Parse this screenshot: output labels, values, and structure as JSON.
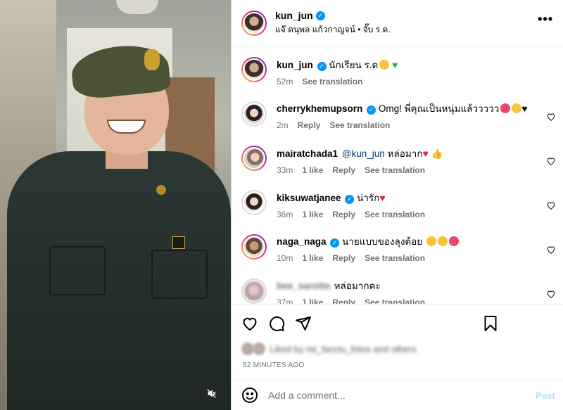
{
  "post": {
    "author": "kun_jun",
    "subtitle": "แจ๊ ดนุพล แก้วกาญจน์ • จั๊บ ร.ด."
  },
  "caption": {
    "user": "kun_jun",
    "text": "นักเรียน ร.ด",
    "time": "52m",
    "see_translation": "See translation"
  },
  "comments": [
    {
      "user": "cherrykhemupsorn",
      "verified": true,
      "text": "Omg! พี่คุณเป็นหนุ่มแล้ววววว",
      "time": "2m",
      "likes": "",
      "reply": "Reply",
      "see_translation": "See translation"
    },
    {
      "user": "mairatchada1",
      "verified": false,
      "mention": "@kun_jun",
      "text": "หล่อมาก",
      "time": "33m",
      "likes": "1 like",
      "reply": "Reply",
      "see_translation": "See translation"
    },
    {
      "user": "kiksuwatjanee",
      "verified": true,
      "text": "น่ารัก",
      "time": "36m",
      "likes": "1 like",
      "reply": "Reply",
      "see_translation": "See translation"
    },
    {
      "user": "naga_naga",
      "verified": true,
      "text": "นายแบบของลุงต้อย",
      "time": "10m",
      "likes": "1 like",
      "reply": "Reply",
      "see_translation": "See translation"
    },
    {
      "user": "bee_sarotta",
      "verified": false,
      "text": "หล่อมากคะ",
      "time": "37m",
      "likes": "1 like",
      "reply": "Reply",
      "see_translation": "See translation"
    }
  ],
  "likes_line": "Liked by mt_fanclu_fotos and others",
  "timestamp": "52 MINUTES AGO",
  "composer": {
    "placeholder": "Add a comment...",
    "post_label": "Post"
  },
  "icons": {
    "more": "more-options-icon",
    "like": "heart-icon",
    "comment": "comment-icon",
    "share": "share-icon",
    "save": "bookmark-icon",
    "emoji": "emoji-icon",
    "mute": "muted-audio-icon"
  },
  "colors": {
    "verified": "#0095f6",
    "link": "#00376b",
    "muted_text": "#737373",
    "post_button": "#b2dffc"
  }
}
